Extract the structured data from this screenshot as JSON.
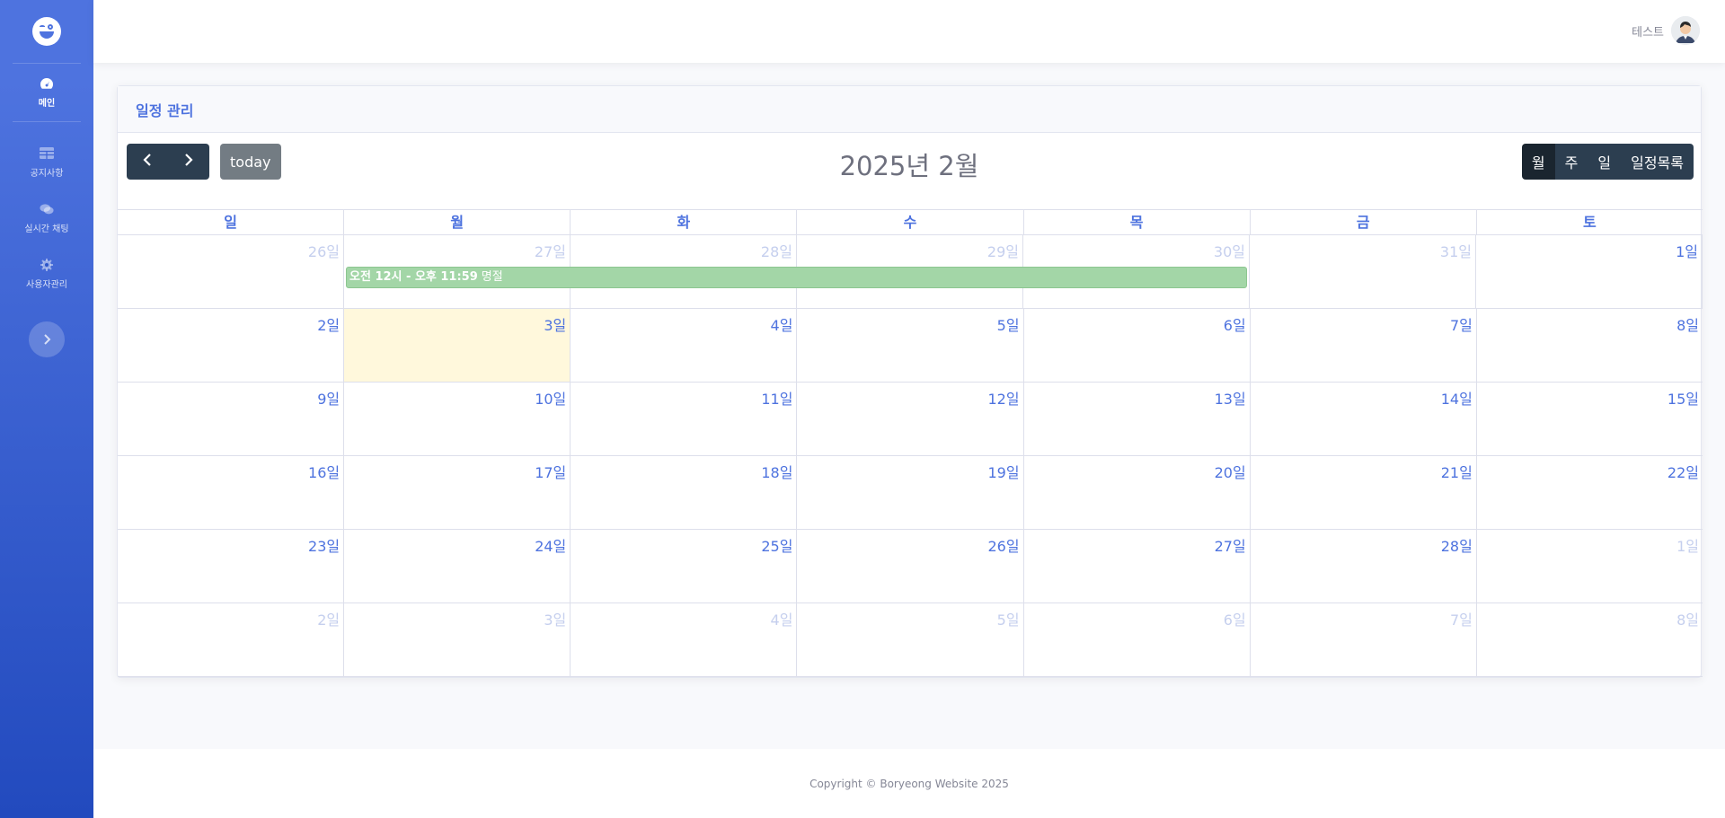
{
  "sidebar": {
    "items": [
      {
        "label": "메인",
        "icon": "tachometer-icon"
      },
      {
        "label": "공지사항",
        "icon": "table-icon"
      },
      {
        "label": "실시간 채팅",
        "icon": "comments-icon"
      },
      {
        "label": "사용자관리",
        "icon": "gear-icon"
      }
    ]
  },
  "topbar": {
    "user_name": "테스트"
  },
  "card": {
    "title": "일정 관리"
  },
  "calendar": {
    "title": "2025년 2월",
    "today_label": "today",
    "views": [
      "월",
      "주",
      "일",
      "일정목록"
    ],
    "active_view": "월",
    "weekdays": [
      "일",
      "월",
      "화",
      "수",
      "목",
      "금",
      "토"
    ],
    "weeks": [
      [
        "26일",
        "27일",
        "28일",
        "29일",
        "30일",
        "31일",
        "1일"
      ],
      [
        "2일",
        "3일",
        "4일",
        "5일",
        "6일",
        "7일",
        "8일"
      ],
      [
        "9일",
        "10일",
        "11일",
        "12일",
        "13일",
        "14일",
        "15일"
      ],
      [
        "16일",
        "17일",
        "18일",
        "19일",
        "20일",
        "21일",
        "22일"
      ],
      [
        "23일",
        "24일",
        "25일",
        "26일",
        "27일",
        "28일",
        "1일"
      ],
      [
        "2일",
        "3일",
        "4일",
        "5일",
        "6일",
        "7일",
        "8일"
      ]
    ],
    "event": {
      "time": "오전 12시 - 오후 11:59",
      "title": "명절",
      "color": "#a3d6a7"
    },
    "today_highlight": "#fff8dc"
  },
  "footer": {
    "copyright": "Copyright © Boryeong Website 2025"
  },
  "colors": {
    "primary": "#4e73df",
    "button_dark": "#2c3e50",
    "today_button": "#6c757d"
  }
}
